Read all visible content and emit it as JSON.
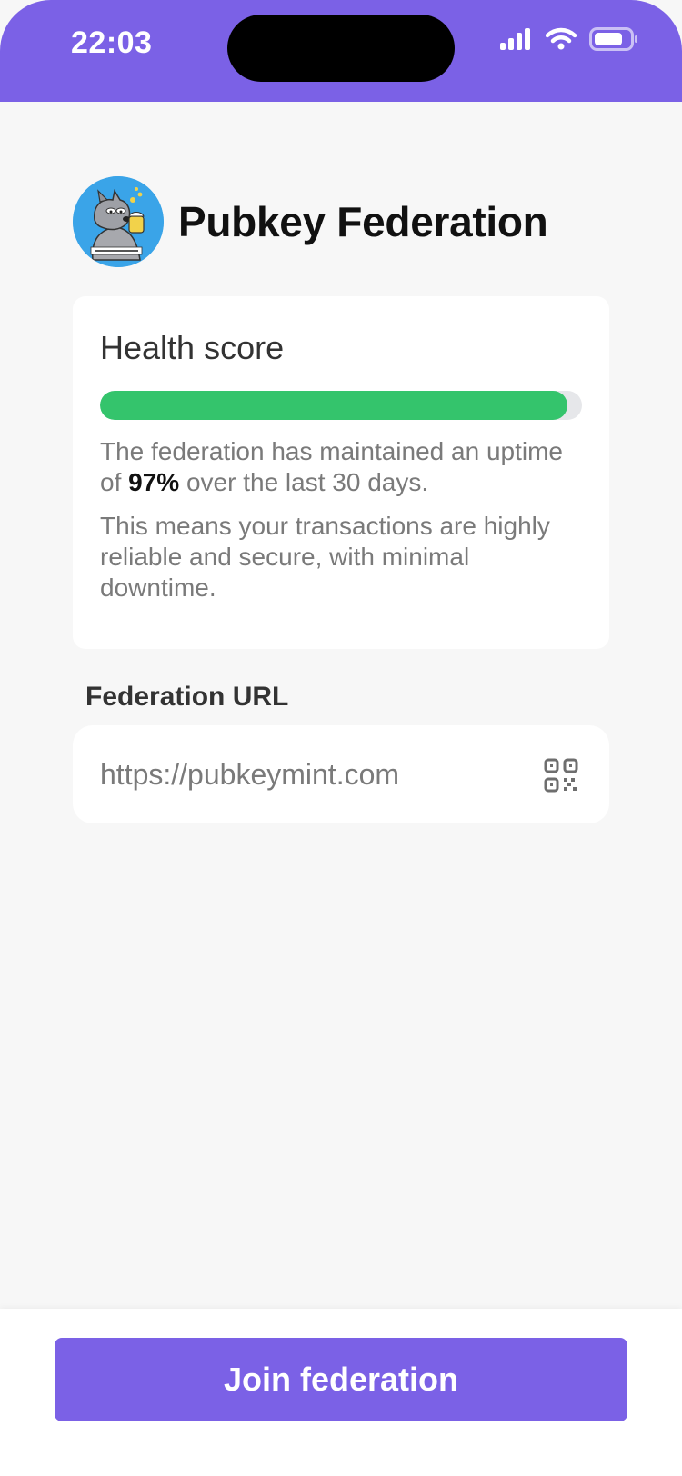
{
  "status_bar": {
    "time": "22:03",
    "icons": [
      "signal-icon",
      "wifi-icon",
      "battery-icon"
    ],
    "background": "#7b61e6"
  },
  "header": {
    "avatar_icon": "wolf-mascot-avatar",
    "title": "Pubkey Federation"
  },
  "health": {
    "title": "Health score",
    "progress_fraction": 0.97,
    "progress_color": "#34c46c",
    "text1_before": "The federation has maintained an uptime of ",
    "text1_value": "97%",
    "text1_after": " over the last 30 days.",
    "text2": "This means your transactions are highly reliable and secure, with minimal downtime."
  },
  "federation_url": {
    "label": "Federation URL",
    "value": "https://pubkeymint.com",
    "icon": "qr-code-icon"
  },
  "footer": {
    "join_label": "Join federation",
    "accent": "#7b61e6"
  }
}
